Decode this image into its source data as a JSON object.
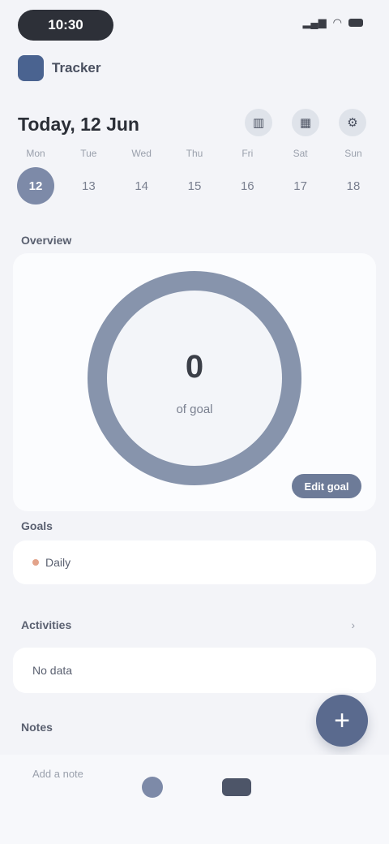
{
  "status_bar": {
    "time": "10:30",
    "icons": [
      "signal-icon",
      "wifi-icon",
      "battery-icon"
    ]
  },
  "app": {
    "name": "Tracker",
    "header_action": ""
  },
  "date_header": {
    "title": "Today, 12 Jun",
    "buttons": [
      "bar-chart-icon",
      "calendar-icon",
      "settings-icon"
    ]
  },
  "week": [
    {
      "name": "Mon",
      "num": "12",
      "selected": true
    },
    {
      "name": "Tue",
      "num": "13",
      "selected": false
    },
    {
      "name": "Wed",
      "num": "14",
      "selected": false
    },
    {
      "name": "Thu",
      "num": "15",
      "selected": false
    },
    {
      "name": "Fri",
      "num": "16",
      "selected": false
    },
    {
      "name": "Sat",
      "num": "17",
      "selected": false
    },
    {
      "name": "Sun",
      "num": "18",
      "selected": false
    }
  ],
  "today": {
    "label": "Overview",
    "value": "0",
    "unit": "of goal",
    "progress": 0,
    "button": "Edit goal"
  },
  "sections": [
    {
      "label": "Goals",
      "row_left": "Daily",
      "row_right": ""
    },
    {
      "label": "Activities",
      "row_left": "No data",
      "row_right": ""
    },
    {
      "label": "Notes",
      "row_left": "Add a note",
      "row_right": ""
    }
  ],
  "fab_label": "+",
  "colors": {
    "accent": "#7d8aa8",
    "fab": "#5a6a8e",
    "ring": "#8794ac"
  }
}
